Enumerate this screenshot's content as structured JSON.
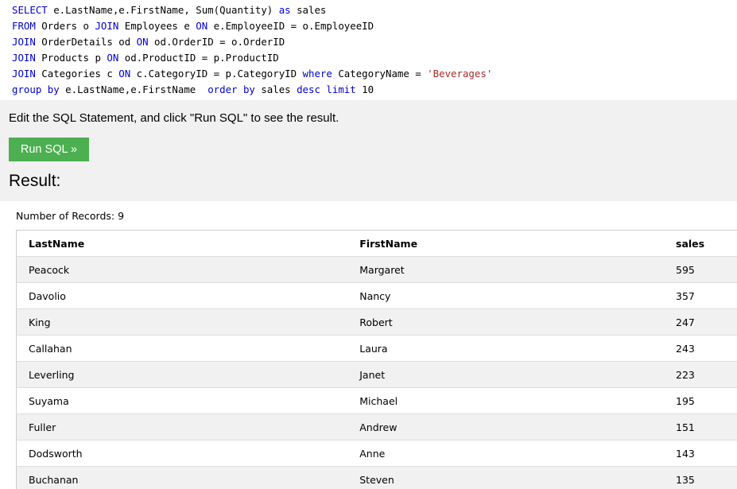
{
  "sql": {
    "lines": [
      [
        {
          "t": "SELECT",
          "k": "kw"
        },
        {
          "t": " e.LastName,e.FirstName, Sum(Quantity) ",
          "k": ""
        },
        {
          "t": "as",
          "k": "kw"
        },
        {
          "t": " sales",
          "k": ""
        }
      ],
      [
        {
          "t": "FROM",
          "k": "kw"
        },
        {
          "t": " Orders o ",
          "k": ""
        },
        {
          "t": "JOIN",
          "k": "kw"
        },
        {
          "t": " Employees e ",
          "k": ""
        },
        {
          "t": "ON",
          "k": "kw"
        },
        {
          "t": " e.EmployeeID = o.EmployeeID",
          "k": ""
        }
      ],
      [
        {
          "t": "JOIN",
          "k": "kw"
        },
        {
          "t": " OrderDetails od ",
          "k": ""
        },
        {
          "t": "ON",
          "k": "kw"
        },
        {
          "t": " od.OrderID = o.OrderID",
          "k": ""
        }
      ],
      [
        {
          "t": "JOIN",
          "k": "kw"
        },
        {
          "t": " Products p ",
          "k": ""
        },
        {
          "t": "ON",
          "k": "kw"
        },
        {
          "t": " od.ProductID = p.ProductID",
          "k": ""
        }
      ],
      [
        {
          "t": "JOIN",
          "k": "kw"
        },
        {
          "t": " Categories c ",
          "k": ""
        },
        {
          "t": "ON",
          "k": "kw"
        },
        {
          "t": " c.CategoryID = p.CategoryID ",
          "k": ""
        },
        {
          "t": "where",
          "k": "kw"
        },
        {
          "t": " CategoryName = ",
          "k": ""
        },
        {
          "t": "'Beverages'",
          "k": "str"
        }
      ],
      [
        {
          "t": "group by",
          "k": "kw"
        },
        {
          "t": " e.LastName,e.FirstName  ",
          "k": ""
        },
        {
          "t": "order by",
          "k": "kw"
        },
        {
          "t": " sales ",
          "k": ""
        },
        {
          "t": "desc",
          "k": "kw"
        },
        {
          "t": " ",
          "k": ""
        },
        {
          "t": "limit",
          "k": "kw"
        },
        {
          "t": " 10",
          "k": ""
        }
      ]
    ]
  },
  "instruction": "Edit the SQL Statement, and click \"Run SQL\" to see the result.",
  "run_button_label": "Run SQL »",
  "result": {
    "heading": "Result:",
    "record_count": "Number of Records: 9",
    "columns": [
      "LastName",
      "FirstName",
      "sales"
    ],
    "rows": [
      [
        "Peacock",
        "Margaret",
        "595"
      ],
      [
        "Davolio",
        "Nancy",
        "357"
      ],
      [
        "King",
        "Robert",
        "247"
      ],
      [
        "Callahan",
        "Laura",
        "243"
      ],
      [
        "Leverling",
        "Janet",
        "223"
      ],
      [
        "Suyama",
        "Michael",
        "195"
      ],
      [
        "Fuller",
        "Andrew",
        "151"
      ],
      [
        "Dodsworth",
        "Anne",
        "143"
      ],
      [
        "Buchanan",
        "Steven",
        "135"
      ]
    ]
  },
  "colors": {
    "keyword": "#0000cd",
    "string": "#a52a2a",
    "run_button": "#4caf50",
    "stripe": "#f1f1f1"
  }
}
